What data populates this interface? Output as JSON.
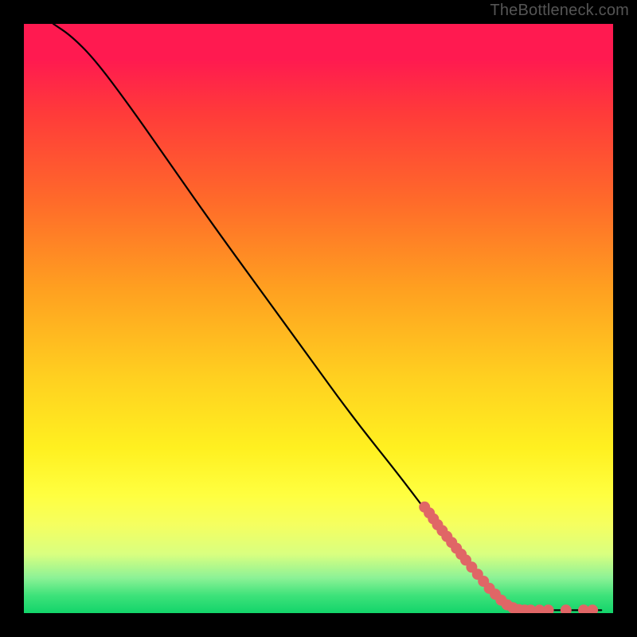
{
  "attribution": "TheBottleneck.com",
  "colors": {
    "background": "#000000",
    "curve": "#000000",
    "marker": "#e06666",
    "gradient_stops": [
      "#ff1a50",
      "#ff3a3a",
      "#ff6a2a",
      "#ffa020",
      "#ffd020",
      "#fff020",
      "#ffff40",
      "#f5ff60",
      "#d9ff80",
      "#8cf296",
      "#3ee27a",
      "#12d46a"
    ]
  },
  "chart_data": {
    "type": "line",
    "title": "",
    "xlabel": "",
    "ylabel": "",
    "xlim": [
      0,
      100
    ],
    "ylim": [
      0,
      100
    ],
    "curve": [
      {
        "x": 5,
        "y": 100
      },
      {
        "x": 8,
        "y": 98
      },
      {
        "x": 12,
        "y": 94
      },
      {
        "x": 18,
        "y": 86
      },
      {
        "x": 25,
        "y": 76
      },
      {
        "x": 32,
        "y": 66
      },
      {
        "x": 40,
        "y": 55
      },
      {
        "x": 48,
        "y": 44
      },
      {
        "x": 56,
        "y": 33
      },
      {
        "x": 64,
        "y": 23
      },
      {
        "x": 70,
        "y": 15
      },
      {
        "x": 76,
        "y": 8
      },
      {
        "x": 80,
        "y": 3
      },
      {
        "x": 83,
        "y": 1
      },
      {
        "x": 86,
        "y": 0.5
      },
      {
        "x": 90,
        "y": 0.5
      },
      {
        "x": 95,
        "y": 0.5
      },
      {
        "x": 98,
        "y": 0.5
      }
    ],
    "markers": [
      {
        "x": 68,
        "y": 18
      },
      {
        "x": 68.8,
        "y": 17
      },
      {
        "x": 69.5,
        "y": 16
      },
      {
        "x": 70.2,
        "y": 15
      },
      {
        "x": 71,
        "y": 14
      },
      {
        "x": 71.8,
        "y": 13
      },
      {
        "x": 72.6,
        "y": 12
      },
      {
        "x": 73.4,
        "y": 11
      },
      {
        "x": 74.2,
        "y": 10
      },
      {
        "x": 75,
        "y": 9
      },
      {
        "x": 76,
        "y": 7.8
      },
      {
        "x": 77,
        "y": 6.6
      },
      {
        "x": 78,
        "y": 5.4
      },
      {
        "x": 79,
        "y": 4.2
      },
      {
        "x": 80,
        "y": 3.2
      },
      {
        "x": 81,
        "y": 2.2
      },
      {
        "x": 82,
        "y": 1.4
      },
      {
        "x": 83,
        "y": 0.9
      },
      {
        "x": 84,
        "y": 0.6
      },
      {
        "x": 85,
        "y": 0.5
      },
      {
        "x": 86,
        "y": 0.5
      },
      {
        "x": 87.5,
        "y": 0.5
      },
      {
        "x": 89,
        "y": 0.5
      },
      {
        "x": 92,
        "y": 0.5
      },
      {
        "x": 95,
        "y": 0.5
      },
      {
        "x": 96.5,
        "y": 0.5
      }
    ]
  }
}
